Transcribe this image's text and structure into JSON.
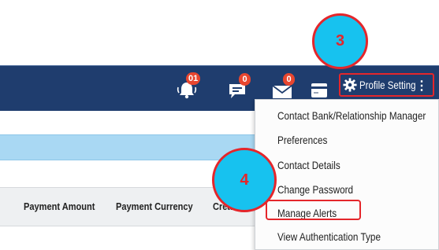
{
  "header": {
    "notifications_badge": "01",
    "messages_badge": "0",
    "mail_badge": "0",
    "profile_label": "Profile Setting"
  },
  "table": {
    "columns": [
      "Payment Amount",
      "Payment Currency",
      "Created By"
    ]
  },
  "menu": {
    "items": [
      "Contact Bank/Relationship Manager",
      "Preferences",
      "Contact Details",
      "Change Password",
      "Manage Alerts",
      "View Authentication Type"
    ]
  },
  "callouts": {
    "step_profile": "3",
    "step_alerts": "4"
  },
  "colors": {
    "topbar": "#1f3d6e",
    "highlight": "#e4262b",
    "callout_fill": "#17c2ef",
    "badge": "#e8462f",
    "band": "#a9d8f3"
  },
  "icons": [
    "bell-icon",
    "chat-icon",
    "mail-icon",
    "card-icon",
    "gear-icon",
    "kebab-menu-icon"
  ]
}
